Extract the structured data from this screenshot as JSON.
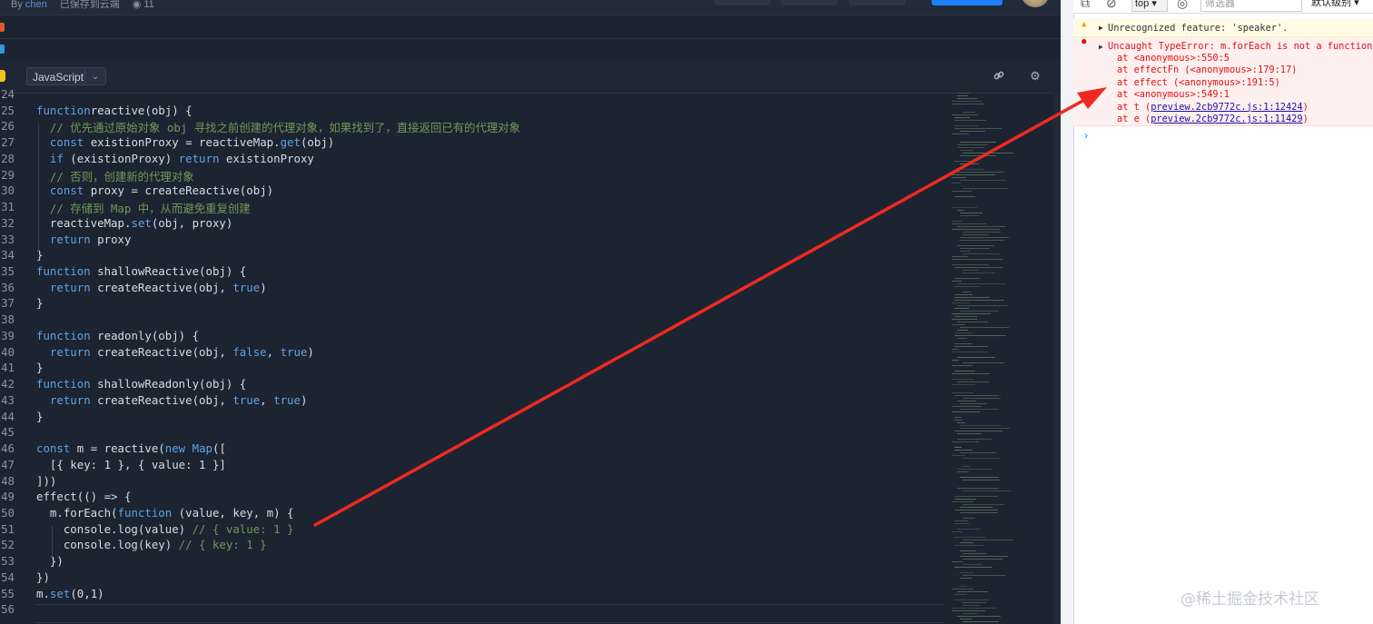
{
  "header": {
    "by": "By",
    "author": "chen",
    "saved": "已保存到云端",
    "views": "11"
  },
  "editor": {
    "language": "JavaScript",
    "lines": [
      {
        "n": "24",
        "t": []
      },
      {
        "n": "25",
        "t": [
          [
            "kw",
            "function"
          ],
          [
            "",
            "reactive(obj) {"
          ]
        ]
      },
      {
        "n": "26",
        "t": [
          [
            "cm",
            "  // 优先通过原始对象 obj 寻找之前创建的代理对象，如果找到了，直接返回已有的代理对象"
          ]
        ]
      },
      {
        "n": "27",
        "t": [
          [
            "",
            "  "
          ],
          [
            "kw",
            "const"
          ],
          [
            "",
            " existionProxy = reactiveMap."
          ],
          [
            "kw",
            "get"
          ],
          [
            "",
            "(obj)"
          ]
        ]
      },
      {
        "n": "28",
        "t": [
          [
            "",
            "  "
          ],
          [
            "kw",
            "if"
          ],
          [
            "",
            " (existionProxy) "
          ],
          [
            "kw",
            "return"
          ],
          [
            "",
            " existionProxy"
          ]
        ]
      },
      {
        "n": "29",
        "t": [
          [
            "cm",
            "  // 否则，创建新的代理对象"
          ]
        ]
      },
      {
        "n": "30",
        "t": [
          [
            "",
            "  "
          ],
          [
            "kw",
            "const"
          ],
          [
            "",
            " proxy = createReactive(obj)"
          ]
        ]
      },
      {
        "n": "31",
        "t": [
          [
            "cm",
            "  // 存储到 Map 中，从而避免重复创建"
          ]
        ]
      },
      {
        "n": "32",
        "t": [
          [
            "",
            "  reactiveMap."
          ],
          [
            "kw",
            "set"
          ],
          [
            "",
            "(obj, proxy)"
          ]
        ]
      },
      {
        "n": "33",
        "t": [
          [
            "",
            "  "
          ],
          [
            "kw",
            "return"
          ],
          [
            "",
            " proxy"
          ]
        ]
      },
      {
        "n": "34",
        "t": [
          [
            "",
            "}"
          ]
        ]
      },
      {
        "n": "35",
        "t": [
          [
            "kw",
            "function"
          ],
          [
            "",
            " shallowReactive(obj) {"
          ]
        ]
      },
      {
        "n": "36",
        "t": [
          [
            "",
            "  "
          ],
          [
            "kw",
            "return"
          ],
          [
            "",
            " createReactive(obj, "
          ],
          [
            "kw",
            "true"
          ],
          [
            "",
            ")"
          ]
        ]
      },
      {
        "n": "37",
        "t": [
          [
            "",
            "}"
          ]
        ]
      },
      {
        "n": "38",
        "t": []
      },
      {
        "n": "39",
        "t": [
          [
            "kw",
            "function"
          ],
          [
            "",
            " readonly(obj) {"
          ]
        ]
      },
      {
        "n": "40",
        "t": [
          [
            "",
            "  "
          ],
          [
            "kw",
            "return"
          ],
          [
            "",
            " createReactive(obj, "
          ],
          [
            "kw",
            "false"
          ],
          [
            "",
            ", "
          ],
          [
            "kw",
            "true"
          ],
          [
            "",
            ")"
          ]
        ]
      },
      {
        "n": "41",
        "t": [
          [
            "",
            "}"
          ]
        ]
      },
      {
        "n": "42",
        "t": [
          [
            "kw",
            "function"
          ],
          [
            "",
            " shallowReadonly(obj) {"
          ]
        ]
      },
      {
        "n": "43",
        "t": [
          [
            "",
            "  "
          ],
          [
            "kw",
            "return"
          ],
          [
            "",
            " createReactive(obj, "
          ],
          [
            "kw",
            "true"
          ],
          [
            "",
            ", "
          ],
          [
            "kw",
            "true"
          ],
          [
            "",
            ")"
          ]
        ]
      },
      {
        "n": "44",
        "t": [
          [
            "",
            "}"
          ]
        ]
      },
      {
        "n": "45",
        "t": []
      },
      {
        "n": "46",
        "t": [
          [
            "kw",
            "const"
          ],
          [
            "",
            " m = reactive("
          ],
          [
            "kw",
            "new"
          ],
          [
            "",
            " "
          ],
          [
            "kw",
            "Map"
          ],
          [
            "",
            "(["
          ]
        ]
      },
      {
        "n": "47",
        "t": [
          [
            "",
            "  [{ key: 1 }, { value: 1 }]"
          ]
        ]
      },
      {
        "n": "48",
        "t": [
          [
            "",
            "]))"
          ]
        ]
      },
      {
        "n": "49",
        "t": [
          [
            "",
            "effect(() => {"
          ]
        ]
      },
      {
        "n": "50",
        "t": [
          [
            "",
            "  m.forEach("
          ],
          [
            "kw",
            "function"
          ],
          [
            "",
            " (value, key, m) {"
          ]
        ]
      },
      {
        "n": "51",
        "t": [
          [
            "",
            "    console.log(value) "
          ],
          [
            "cm",
            "// { value: 1 }"
          ]
        ]
      },
      {
        "n": "52",
        "t": [
          [
            "",
            "    console.log(key) "
          ],
          [
            "cm",
            "// { key: 1 }"
          ]
        ]
      },
      {
        "n": "53",
        "t": [
          [
            "",
            "  })"
          ]
        ]
      },
      {
        "n": "54",
        "t": [
          [
            "",
            "})"
          ]
        ]
      },
      {
        "n": "55",
        "t": [
          [
            "",
            "m."
          ],
          [
            "kw",
            "set"
          ],
          [
            "",
            "(0,1)"
          ]
        ]
      },
      {
        "n": "56",
        "t": []
      }
    ]
  },
  "devtools": {
    "context": "top",
    "filter_placeholder": "筛选器",
    "level": "默认级别",
    "warning": "Unrecognized feature: 'speaker'.",
    "error": "Uncaught TypeError: m.forEach is not a function",
    "stack": [
      {
        "pre": "at <anonymous>:550:5",
        "link": ""
      },
      {
        "pre": "at effectFn (<anonymous>:179:17)",
        "link": ""
      },
      {
        "pre": "at effect (<anonymous>:191:5)",
        "link": ""
      },
      {
        "pre": "at <anonymous>:549:1",
        "link": ""
      },
      {
        "pre": "at t (",
        "link": "preview.2cb9772c.js:1:12424",
        "post": ")"
      },
      {
        "pre": "at e (",
        "link": "preview.2cb9772c.js:1:11429",
        "post": ")"
      }
    ],
    "prompt": "›"
  },
  "watermark": "@稀土掘金技术社区",
  "colors": {
    "editor_bg": "#1c2331",
    "keyword": "#5fa3e6",
    "comment": "#6e9b58",
    "error": "#e01010",
    "arrow": "#ee2a1f"
  }
}
